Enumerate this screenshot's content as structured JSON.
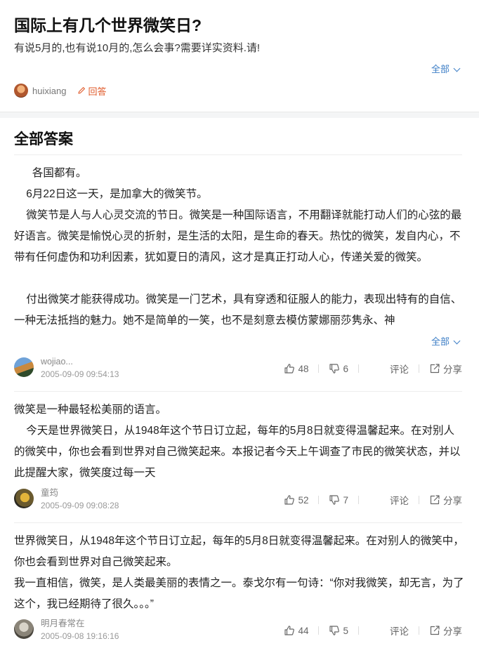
{
  "question": {
    "title": "国际上有几个世界微笑日?",
    "description": "有说5月的,也有说10月的,怎么会事?需要详实资料.请!",
    "expand_label": "全部",
    "asker": "huixiang",
    "answer_label": "回答"
  },
  "answers_section": {
    "title": "全部答案",
    "items": [
      {
        "paragraphs": [
          "      各国都有。",
          "    6月22日这一天，是加拿大的微笑节。",
          "    微笑节是人与人心灵交流的节日。微笑是一种国际语言，不用翻译就能打动人们的心弦的最好语言。微笑是愉悦心灵的折射，是生活的太阳，是生命的春天。热忱的微笑，发自内心，不带有任何虚伪和功利因素，犹如夏日的清风，这才是真正打动人心，传递关爱的微笑。",
          "",
          "    付出微笑才能获得成功。微笑是一门艺术，具有穿透和征服人的能力，表现出特有的自信、一种无法抵挡的魅力。她不是简单的一笑，也不是刻意去模仿蒙娜丽莎隽永、神"
        ],
        "expand_label": "全部",
        "author": "wojiao...",
        "time": "2005-09-09 09:54:13",
        "likes": "48",
        "dislikes": "6",
        "comment_label": "评论",
        "share_label": "分享"
      },
      {
        "paragraphs": [
          "微笑是一种最轻松美丽的语言。",
          "    今天是世界微笑日，从1948年这个节日订立起，每年的5月8日就变得温馨起来。在对别人的微笑中，你也会看到世界对自己微笑起来。本报记者今天上午调查了市民的微笑状态，并以此提醒大家，微笑度过每一天"
        ],
        "author": "童筠",
        "time": "2005-09-09 09:08:28",
        "likes": "52",
        "dislikes": "7",
        "comment_label": "评论",
        "share_label": "分享"
      },
      {
        "paragraphs": [
          "世界微笑日，从1948年这个节日订立起，每年的5月8日就变得温馨起来。在对别人的微笑中，你也会看到世界对自己微笑起来。",
          "我一直相信，微笑，是人类最美丽的表情之一。泰戈尔有一句诗：“你对我微笑，却无言，为了这个，我已经期待了很久。。。”"
        ],
        "author": "明月春常在",
        "time": "2005-09-08 19:16:16",
        "likes": "44",
        "dislikes": "5",
        "comment_label": "评论",
        "share_label": "分享"
      }
    ]
  },
  "colors": {
    "link_blue": "#3c7ec6",
    "answer_orange": "#e05a2a",
    "meta_gray": "#999999"
  }
}
